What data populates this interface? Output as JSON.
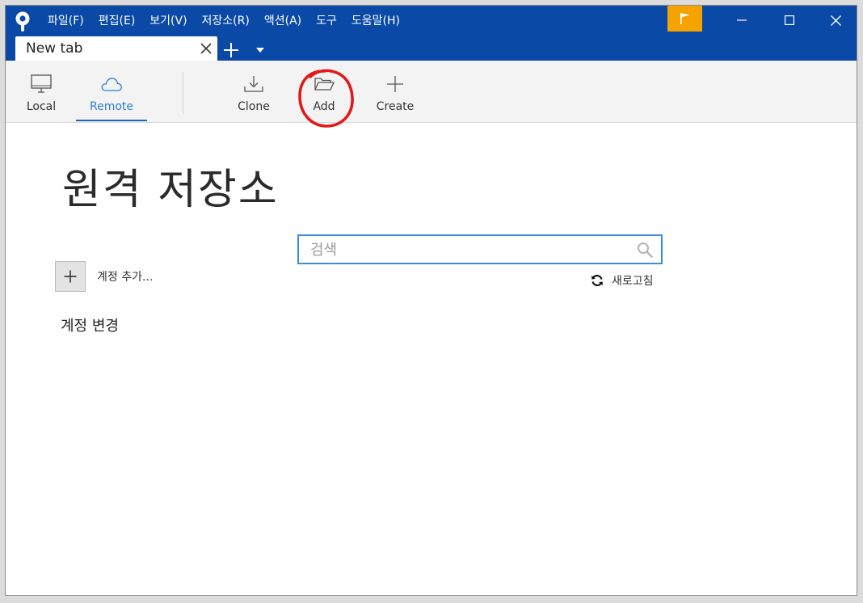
{
  "menu": {
    "items": [
      "파일(F)",
      "편집(E)",
      "보기(V)",
      "저장소(R)",
      "액션(A)",
      "도구",
      "도움말(H)"
    ]
  },
  "tab": {
    "title": "New tab"
  },
  "toolbar": {
    "local_label": "Local",
    "remote_label": "Remote",
    "clone_label": "Clone",
    "add_label": "Add",
    "create_label": "Create",
    "active": "Remote"
  },
  "main": {
    "page_title": "원격 저장소",
    "search_placeholder": "검색",
    "search_value": "",
    "add_account_label": "계정 추가...",
    "refresh_label": "새로고침",
    "change_account_label": "계정 변경"
  },
  "colors": {
    "titlebar": "#0a4aa6",
    "flag_button": "#f5a300",
    "accent": "#2b7fd6",
    "annotation": "#e01a1a"
  },
  "icons": {
    "app": "sourcetree-logo",
    "flag": "flag-icon",
    "local": "monitor-icon",
    "remote": "cloud-icon",
    "clone": "download-icon",
    "add": "folder-open-icon",
    "create": "plus-icon",
    "search": "search-icon",
    "refresh": "refresh-icon"
  }
}
